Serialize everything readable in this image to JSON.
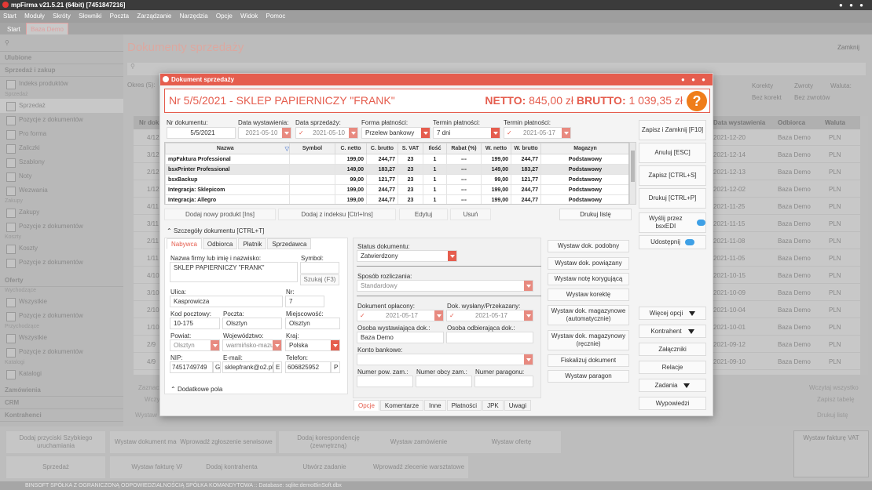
{
  "app": {
    "title": "mpFirma v21.5.21 (64bit) [7451847216]",
    "menu": [
      "Start",
      "Moduły",
      "Skróty",
      "Słowniki",
      "Poczta",
      "Zarządzanie",
      "Narzędzia",
      "Opcje",
      "Widok",
      "Pomoc"
    ],
    "tabs": [
      "Start",
      "Baza Demo"
    ]
  },
  "sidebar": {
    "sections": [
      {
        "label": "Ulubione"
      },
      {
        "label": "Sprzedaż i zakup"
      }
    ],
    "items": [
      "Indeks produktów",
      "Sprzedaż",
      "Sprzedaż",
      "Pozycje z dokumentów",
      "Pro forma",
      "Zaliczki",
      "Szablony",
      "Noty",
      "Wezwania",
      "Zakupy",
      "Zakupy",
      "Pozycje z dokumentów",
      "Koszty",
      "Koszty",
      "Pozycje z dokumentów"
    ],
    "oferty": "Oferty",
    "ofertyGroups": [
      "Wychodzące",
      "Wszystkie",
      "Pozycje z dokumentów",
      "Przychodzące",
      "Wszystkie",
      "Pozycje z dokumentów",
      "Katalogi",
      "Katalogi"
    ],
    "bottomSections": [
      "Zamówienia",
      "CRM",
      "Kontrahenci"
    ]
  },
  "background": {
    "title": "Dokumenty sprzedaży",
    "zamknij": "Zamknij",
    "okres": "Okres (5):",
    "headers": [
      "Nr dok",
      "Data wystawienia",
      "Odbiorca",
      "Waluta"
    ],
    "filters": [
      "Korekty",
      "Zwroty",
      "Waluta:",
      "Bez korekt",
      "Bez zwrotów"
    ],
    "rows": [
      {
        "nr": "4/12",
        "date": "2021-12-20",
        "odb": "Baza Demo",
        "wal": "PLN"
      },
      {
        "nr": "3/12",
        "date": "2021-12-14",
        "odb": "Baza Demo",
        "wal": "PLN"
      },
      {
        "nr": "2/12",
        "date": "2021-12-13",
        "odb": "Baza Demo",
        "wal": "PLN"
      },
      {
        "nr": "1/12",
        "date": "2021-12-02",
        "odb": "Baza Demo",
        "wal": "PLN"
      },
      {
        "nr": "4/11",
        "date": "2021-11-25",
        "odb": "Baza Demo",
        "wal": "PLN"
      },
      {
        "nr": "3/11",
        "date": "2021-11-15",
        "odb": "Baza Demo",
        "wal": "PLN"
      },
      {
        "nr": "2/11",
        "date": "2021-11-08",
        "odb": "Baza Demo",
        "wal": "PLN"
      },
      {
        "nr": "1/11",
        "date": "2021-11-05",
        "odb": "Baza Demo",
        "wal": "PLN"
      },
      {
        "nr": "4/10",
        "date": "2021-10-15",
        "odb": "Baza Demo",
        "wal": "PLN"
      },
      {
        "nr": "3/10",
        "date": "2021-10-09",
        "odb": "Baza Demo",
        "wal": "PLN"
      },
      {
        "nr": "2/10",
        "date": "2021-10-04",
        "odb": "Baza Demo",
        "wal": "PLN"
      },
      {
        "nr": "1/10",
        "date": "2021-10-01",
        "odb": "Baza Demo",
        "wal": "PLN"
      },
      {
        "nr": "2/9",
        "date": "2021-09-12",
        "odb": "Baza Demo",
        "wal": "PLN"
      },
      {
        "nr": "4/9",
        "date": "2021-09-10",
        "odb": "Baza Demo",
        "wal": "PLN"
      }
    ],
    "rightButtons": [
      "Wczytaj wszystko",
      "Zapisz tabelę",
      "Drukuj listę"
    ],
    "leftLabels": [
      "Zaznacz",
      "Wczy",
      "Wystaw"
    ],
    "bottomButtons": [
      "Dodaj przyciski Szybkiego uruchamiania",
      "Wystaw dokument magazynowy",
      "Wprowadź zgłoszenie serwisowe",
      "Dodaj korespondencję (zewnętrzną)",
      "Wystaw zamówienie",
      "Wystaw ofertę",
      "Sprzedaż",
      "Wystaw fakturę VAT",
      "Dodaj kontrahenta",
      "Utwórz zadanie",
      "Wprowadź zlecenie warsztatowe"
    ],
    "wystawFakture": "Wystaw fakturę VAT",
    "status": "BINSOFT SPÓŁKA Z OGRANICZONĄ ODPOWIEDZIALNOŚCIĄ SPÓŁKA KOMANDYTOWA :: Database: sqlite:demoBinSoft.dbx"
  },
  "dialog": {
    "title": "Dokument sprzedaży",
    "docTitle": "Nr 5/5/2021 - SKLEP PAPIERNICZY \"FRANK\"",
    "nettoLabel": "NETTO:",
    "nettoValue": "845,00 zł",
    "bruttoLabel": "BRUTTO:",
    "bruttoValue": "1 039,35 zł",
    "fields": {
      "nrLabel": "Nr dokumentu:",
      "nr": "5/5/2021",
      "dataWystLabel": "Data wystawienia:",
      "dataWyst": "2021-05-10",
      "dataSprzLabel": "Data sprzedaży:",
      "dataSprz": "2021-05-10",
      "formaLabel": "Forma płatności:",
      "forma": "Przelew bankowy",
      "terminLabel": "Termin płatności:",
      "termin": "7 dni",
      "termin2Label": "Termin płatności:",
      "termin2": "2021-05-17"
    },
    "products": {
      "headers": [
        "Nazwa",
        "Symbol",
        "C. netto",
        "C. brutto",
        "S. VAT",
        "Ilość",
        "Rabat (%)",
        "W. netto",
        "W. brutto",
        "Magazyn"
      ],
      "rows": [
        [
          "mpFaktura Professional",
          "",
          "199,00",
          "244,77",
          "23",
          "1",
          "---",
          "199,00",
          "244,77",
          "Podstawowy"
        ],
        [
          "bsxPrinter Professional",
          "",
          "149,00",
          "183,27",
          "23",
          "1",
          "---",
          "149,00",
          "183,27",
          "Podstawowy"
        ],
        [
          "bsxBackup",
          "",
          "99,00",
          "121,77",
          "23",
          "1",
          "---",
          "99,00",
          "121,77",
          "Podstawowy"
        ],
        [
          "Integracja: Sklepicom",
          "",
          "199,00",
          "244,77",
          "23",
          "1",
          "---",
          "199,00",
          "244,77",
          "Podstawowy"
        ],
        [
          "Integracja: Allegro",
          "",
          "199,00",
          "244,77",
          "23",
          "1",
          "---",
          "199,00",
          "244,77",
          "Podstawowy"
        ]
      ]
    },
    "tableButtons": [
      "Dodaj nowy produkt [Ins]",
      "Dodaj z indeksu [Ctrl+Ins]",
      "Edytuj",
      "Usuń",
      "Drukuj listę"
    ],
    "szczegoly": "Szczegóły dokumentu [CTRL+T]",
    "partyTabs": [
      "Nabywca",
      "Odbiorca",
      "Płatnik",
      "Sprzedawca"
    ],
    "party": {
      "nazwaLabel": "Nazwa firmy lub imię i nazwisko:",
      "nazwa": "SKLEP PAPIERNICZY \"FRANK\"",
      "symbolLabel": "Symbol:",
      "symbol": "",
      "szukaj": "Szukaj (F3)",
      "ulicaLabel": "Ulica:",
      "ulica": "Kasprowicza",
      "nrLabel": "Nr:",
      "nr": "7",
      "kodLabel": "Kod pocztowy:",
      "kod": "10-175",
      "pocztaLabel": "Poczta:",
      "poczta": "Olsztyn",
      "miejscLabel": "Miejscowość:",
      "miejsc": "Olsztyn",
      "powiatLabel": "Powiat:",
      "powiat": "Olsztyn",
      "wojLabel": "Województwo:",
      "woj": "warmińsko-mazu",
      "krajLabel": "Kraj:",
      "kraj": "Polska",
      "nipLabel": "NIP:",
      "nip": "7451749749",
      "nipG": "G",
      "emailLabel": "E-mail:",
      "email": "sklepfrank@o2.pl",
      "emailE": "E",
      "telLabel": "Telefon:",
      "tel": "606825952",
      "telP": "P"
    },
    "dodatkowe": "Dodatkowe pola",
    "mid": {
      "statusLabel": "Status dokumentu:",
      "status": "Zatwierdzony",
      "sposobLabel": "Sposób rozliczania:",
      "sposob": "Standardowy",
      "oplaconyLabel": "Dokument opłacony:",
      "oplacony": "2021-05-17",
      "wyslanyLabel": "Dok. wysłany/Przekazany:",
      "wyslany": "2021-05-17",
      "osobaWystLabel": "Osoba wystawiająca dok.:",
      "osobaWyst": "Baza Demo",
      "osobaOdbLabel": "Osoba odbierająca dok.:",
      "osobaOdb": "",
      "kontoLabel": "Konto bankowe:",
      "konto": "",
      "numerPowLabel": "Numer pow. zam.:",
      "numerObcyLabel": "Numer obcy zam.:",
      "numerParLabel": "Numer paragonu:"
    },
    "bottomTabs": [
      "Opcje",
      "Komentarze",
      "Inne",
      "Płatności",
      "JPK",
      "Uwagi"
    ],
    "actionButtons": [
      "Wystaw dok. podobny",
      "Wystaw dok. powiązany",
      "Wystaw notę korygującą",
      "Wystaw korektę",
      "Wystaw dok. magazynowe (automatycznie)",
      "Wystaw dok. magazynowy (ręcznie)",
      "Fiskalizuj dokument",
      "Wystaw paragon"
    ],
    "rightButtons": {
      "zapisz": "Zapisz i Zamknij [F10]",
      "anuluj": "Anuluj [ESC]",
      "zapisz2": "Zapisz [CTRL+S]",
      "drukuj": "Drukuj [CTRL+P]",
      "wyslij": "Wyślij przez bsxEDI",
      "udostepnij": "Udostępnij",
      "wiecej": "Więcej opcji",
      "kontrahent": "Kontrahent",
      "zalaczniki": "Załączniki",
      "relacje": "Relacje",
      "zadania": "Zadania",
      "wypowiedzi": "Wypowiedzi"
    },
    "accent": "#e55d4e"
  }
}
